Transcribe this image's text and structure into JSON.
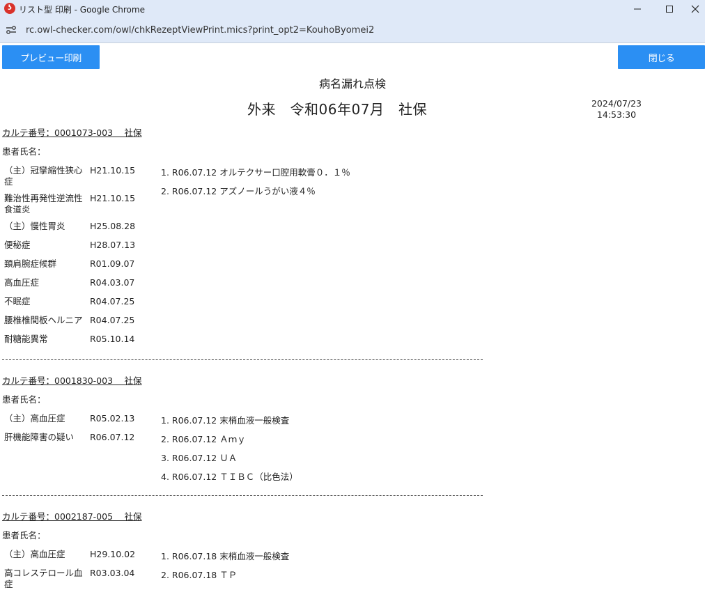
{
  "window": {
    "title": "リスト型 印刷 - Google Chrome",
    "url": "rc.owl-checker.com/owl/chkRezeptViewPrint.mics?print_opt2=KouhoByomei2"
  },
  "toolbar": {
    "preview_label": "プレビュー印刷",
    "close_label": "閉じる"
  },
  "report": {
    "title": "病名漏れ点検",
    "subtitle": "外来　令和06年07月　社保",
    "print_date": "2024/07/23",
    "print_time": "14:53:30"
  },
  "records": [
    {
      "karte": "カルテ番号：0001073-003　 社保",
      "patient": "患者氏名：",
      "diagnoses": [
        {
          "name": "（主）冠攣縮性狭心症",
          "date": "H21.10.15"
        },
        {
          "name": "難治性再発性逆流性食道炎",
          "date": "H21.10.15"
        },
        {
          "name": "（主）慢性胃炎",
          "date": "H25.08.28"
        },
        {
          "name": "便秘症",
          "date": "H28.07.13"
        },
        {
          "name": "頚肩腕症候群",
          "date": "R01.09.07"
        },
        {
          "name": "高血圧症",
          "date": "R04.03.07"
        },
        {
          "name": "不眠症",
          "date": "R04.07.25"
        },
        {
          "name": "腰椎椎間板ヘルニア",
          "date": "R04.07.25"
        },
        {
          "name": "耐糖能異常",
          "date": "R05.10.14"
        }
      ],
      "orders": [
        "1. R06.07.12 オルテクサー口腔用軟膏０．１％",
        "2. R06.07.12 アズノールうがい液４％"
      ]
    },
    {
      "karte": "カルテ番号：0001830-003　 社保",
      "patient": "患者氏名：",
      "diagnoses": [
        {
          "name": "（主）高血圧症",
          "date": "R05.02.13"
        },
        {
          "name": "肝機能障害の疑い",
          "date": "R06.07.12"
        }
      ],
      "orders": [
        "1. R06.07.12 末梢血液一般検査",
        "2. R06.07.12 Ａｍｙ",
        "3. R06.07.12 ＵＡ",
        "4. R06.07.12 ＴＩＢＣ（比色法）"
      ]
    },
    {
      "karte": "カルテ番号：0002187-005　 社保",
      "patient": "患者氏名：",
      "diagnoses": [
        {
          "name": "（主）高血圧症",
          "date": "H29.10.02"
        },
        {
          "name": "高コレステロール血症",
          "date": "R03.03.04"
        }
      ],
      "orders": [
        "1. R06.07.18 末梢血液一般検査",
        "2. R06.07.18 ＴＰ"
      ]
    }
  ]
}
